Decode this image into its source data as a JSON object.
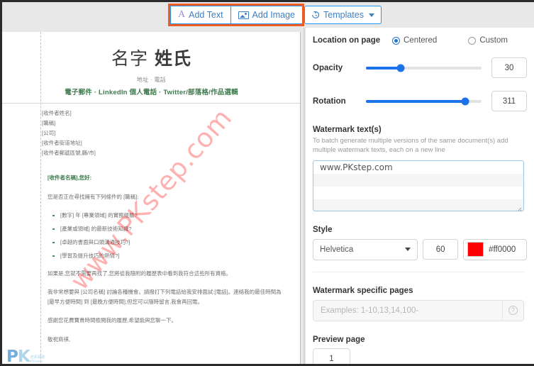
{
  "toolbar": {
    "add_text_label": "Add Text",
    "add_text_icon": "text-A-icon",
    "add_image_label": "Add Image",
    "add_image_icon": "image-icon",
    "templates_label": "Templates",
    "templates_icon": "history-clock-icon",
    "highlight_color": "#ef5c23",
    "accent_color": "#2196f3"
  },
  "document": {
    "name_first": "名字",
    "name_last": "姓氏",
    "contact_line1": "地址 · 電話",
    "contact_line2": "電子郵件 · LinkedIn 個人電話 · Twitter/部落格/作品選輯",
    "address_block": [
      "[收件者姓名]",
      "[職稱]",
      "[公司]",
      "[收件者街道地址]",
      "[收件者郵遞區號,縣/市]"
    ],
    "greeting": "[收件者名稱],您好:",
    "intro_paragraph": "您是否正在尋找擁有下列條件的 [職稱]:",
    "bullets": [
      "[數字] 年 [專業領域] 的實務經驗?",
      "[產業或領域] 的最新技術知識?",
      "[卓越的書面與口頭溝通技巧?]",
      "[學習及提升技巧的熱情?]"
    ],
    "paragraph_2": "如果是,您就不需要再找了,您將從我隨附的履歷表中看到我符合這些所有資格。",
    "paragraph_3": "我非常想要與 [公司名稱] 討論各種機會。請撥打下列電話給我安排面試:[電話]。連絡我的最佳時間為 [最早方便時間] 到 [最晚方便時間],但您可以隨時留言,我會再回電。",
    "paragraph_4": "感謝您花費寶貴時間檢閱我的履歷,希望能與您聊一下。",
    "signature": "敬祝商祺,",
    "watermark_text": "www.PKstep.com",
    "watermark_color": "#ff0000",
    "watermark_opacity": "30",
    "watermark_rotation": "311",
    "logo_pk": "PK",
    "logo_sub_line1": "痞凱踏踏",
    "logo_sub_line2": "PKstep"
  },
  "panel": {
    "location": {
      "label": "Location on page",
      "option_centered": "Centered",
      "option_custom": "Custom",
      "selected": "Centered"
    },
    "opacity": {
      "label": "Opacity",
      "value": "30",
      "percent": 30
    },
    "rotation": {
      "label": "Rotation",
      "value": "311",
      "percent": 86
    },
    "watermark_texts": {
      "label": "Watermark text(s)",
      "description": "To batch generate multiple versions of the same document(s) add multiple watermark texts, each on a new line",
      "value": "www.PKstep.com"
    },
    "style": {
      "label": "Style",
      "font": "Helvetica",
      "size": "60",
      "color_hex": "#ff0000"
    },
    "specific_pages": {
      "label": "Watermark specific pages",
      "placeholder": "Examples: 1-10,13,14,100-",
      "value": "",
      "help_icon": "question-mark-icon"
    },
    "preview_page": {
      "label": "Preview page",
      "value": "1"
    }
  }
}
